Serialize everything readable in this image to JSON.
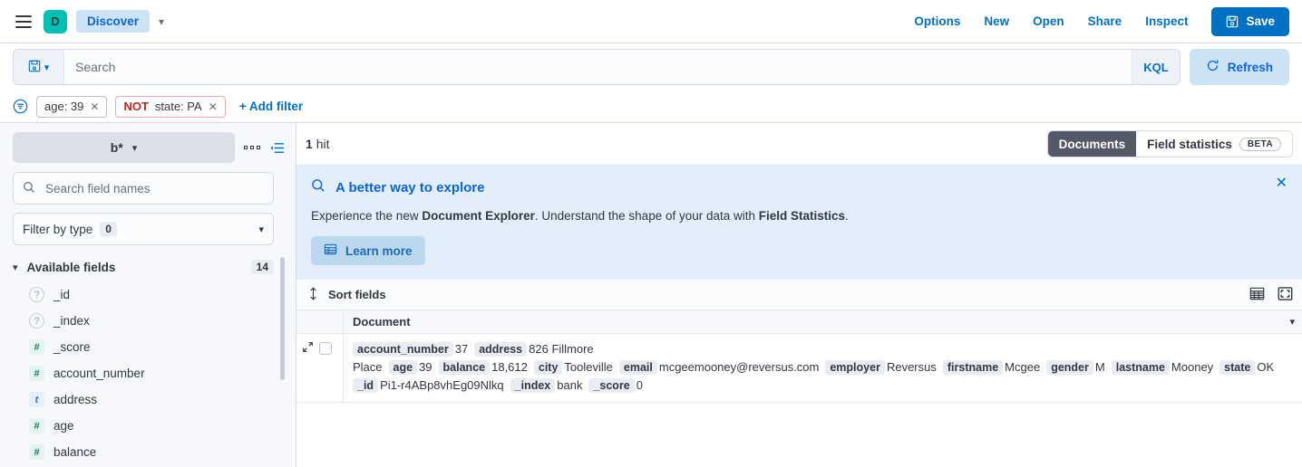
{
  "topnav": {
    "menu_icon": "hamburger-icon",
    "avatar_letter": "D",
    "breadcrumb": "Discover",
    "links": [
      "Options",
      "New",
      "Open",
      "Share",
      "Inspect"
    ],
    "save_label": "Save",
    "save_icon": "save-disk-icon",
    "accent": "#0071c2"
  },
  "querybar": {
    "saved_query_icon": "save-disk-icon",
    "search_placeholder": "Search",
    "search_value": "",
    "language_label": "KQL",
    "refresh_label": "Refresh",
    "refresh_icon": "refresh-icon"
  },
  "filterbar": {
    "filter_menu_icon": "filter-icon",
    "filters": [
      {
        "prefix": "",
        "label": "age: 39",
        "negated": false,
        "remove_icon": "close-icon"
      },
      {
        "prefix": "NOT",
        "label": "state: PA",
        "negated": true,
        "remove_icon": "close-icon"
      }
    ],
    "add_filter_label": "+ Add filter"
  },
  "sidebar": {
    "data_view": "b*",
    "data_view_chevron": "chevron-down-icon",
    "options_icon": "grid-dots-icon",
    "collapse_icon": "collapse-sidebar-icon",
    "search_placeholder": "Search field names",
    "search_value": "",
    "filter_by_type_label": "Filter by type",
    "filter_by_type_count": "0",
    "available_fields_label": "Available fields",
    "available_fields_count": "14",
    "fields": [
      {
        "name": "_id",
        "type": "unknown",
        "glyph": "?"
      },
      {
        "name": "_index",
        "type": "unknown",
        "glyph": "?"
      },
      {
        "name": "_score",
        "type": "number",
        "glyph": "#"
      },
      {
        "name": "account_number",
        "type": "number",
        "glyph": "#"
      },
      {
        "name": "address",
        "type": "string",
        "glyph": "t"
      },
      {
        "name": "age",
        "type": "number",
        "glyph": "#"
      },
      {
        "name": "balance",
        "type": "number",
        "glyph": "#"
      }
    ]
  },
  "main": {
    "hits_count": "1",
    "hits_label": "hit",
    "tabs": [
      {
        "label": "Documents",
        "active": true,
        "badge": ""
      },
      {
        "label": "Field statistics",
        "active": false,
        "badge": "BETA"
      }
    ],
    "callout": {
      "icon": "search-icon",
      "title": "A better way to explore",
      "body_prefix": "Experience the new ",
      "body_bold1": "Document Explorer",
      "body_middle": ". Understand the shape of your data with ",
      "body_bold2": "Field Statistics",
      "body_suffix": ".",
      "button_label": "Learn more",
      "button_icon": "table-icon",
      "close_icon": "close-icon"
    },
    "sortbar": {
      "sort_icon": "sort-updown-icon",
      "sort_label": "Sort fields",
      "density_icon": "table-density-icon",
      "fullscreen_icon": "fullscreen-icon"
    },
    "table": {
      "column_header": "Document",
      "header_chevron": "chevron-down-icon",
      "row": {
        "expand_icon": "expand-row-icon",
        "select_checkbox": "row-select-checkbox",
        "pairs": [
          {
            "field": "account_number",
            "value": "37"
          },
          {
            "field": "address",
            "value": "826 Fillmore Place"
          },
          {
            "field": "age",
            "value": "39"
          },
          {
            "field": "balance",
            "value": "18,612"
          },
          {
            "field": "city",
            "value": "Tooleville"
          },
          {
            "field": "email",
            "value": "mcgeemooney@reversus.com"
          },
          {
            "field": "employer",
            "value": "Reversus"
          },
          {
            "field": "firstname",
            "value": "Mcgee"
          },
          {
            "field": "gender",
            "value": "M"
          },
          {
            "field": "lastname",
            "value": "Mooney"
          },
          {
            "field": "state",
            "value": "OK"
          },
          {
            "field": "_id",
            "value": "Pi1-r4ABp8vhEg09Nlkq"
          },
          {
            "field": "_index",
            "value": "bank"
          },
          {
            "field": "_score",
            "value": "0"
          }
        ]
      }
    }
  }
}
